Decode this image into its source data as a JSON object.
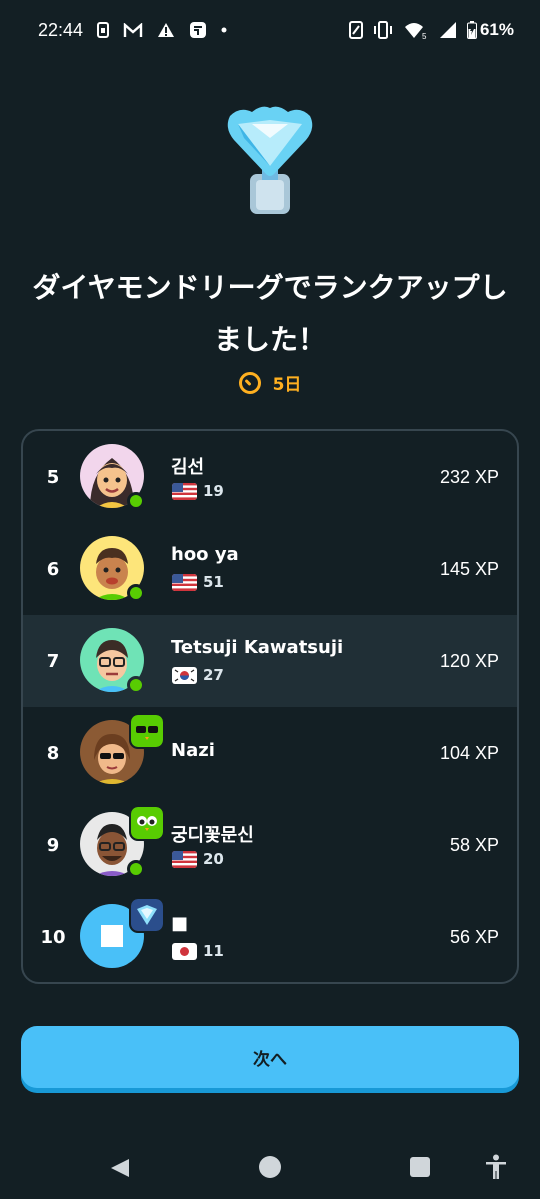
{
  "status_bar": {
    "time": "22:44",
    "battery": "61%",
    "left_icons": [
      "sim-icon",
      "gmail-icon",
      "warning-icon",
      "app-icon",
      "dot-icon"
    ],
    "right_icons": [
      "nfc-icon",
      "vibrate-icon",
      "wifi-icon",
      "signal-icon",
      "battery-icon"
    ]
  },
  "header": {
    "title_line1": "ダイヤモンドリーグでランクアップし",
    "title_line2": "ました！",
    "days_left": "5日"
  },
  "leaderboard": {
    "rows": [
      {
        "rank": "5",
        "name": "김선",
        "flag": "us",
        "streak": "19",
        "xp": "232 XP",
        "online": true
      },
      {
        "rank": "6",
        "name": "hoo ya",
        "flag": "us",
        "streak": "51",
        "xp": "145 XP",
        "online": true
      },
      {
        "rank": "7",
        "name": "Tetsuji Kawatsuji",
        "flag": "kr",
        "streak": "27",
        "xp": "120 XP",
        "online": true,
        "current_user": true
      },
      {
        "rank": "8",
        "name": "Nazi",
        "xp": "104 XP"
      },
      {
        "rank": "9",
        "name": "궁디꽃문신",
        "flag": "us",
        "streak": "20",
        "xp": "58 XP",
        "online": true
      },
      {
        "rank": "10",
        "name": "■",
        "flag": "jp",
        "streak": "11",
        "xp": "56 XP"
      }
    ]
  },
  "actions": {
    "next_label": "次へ"
  },
  "colors": {
    "background": "#131f24",
    "accent": "#49c0f8",
    "timer": "#ffb020",
    "online": "#58cc02"
  }
}
